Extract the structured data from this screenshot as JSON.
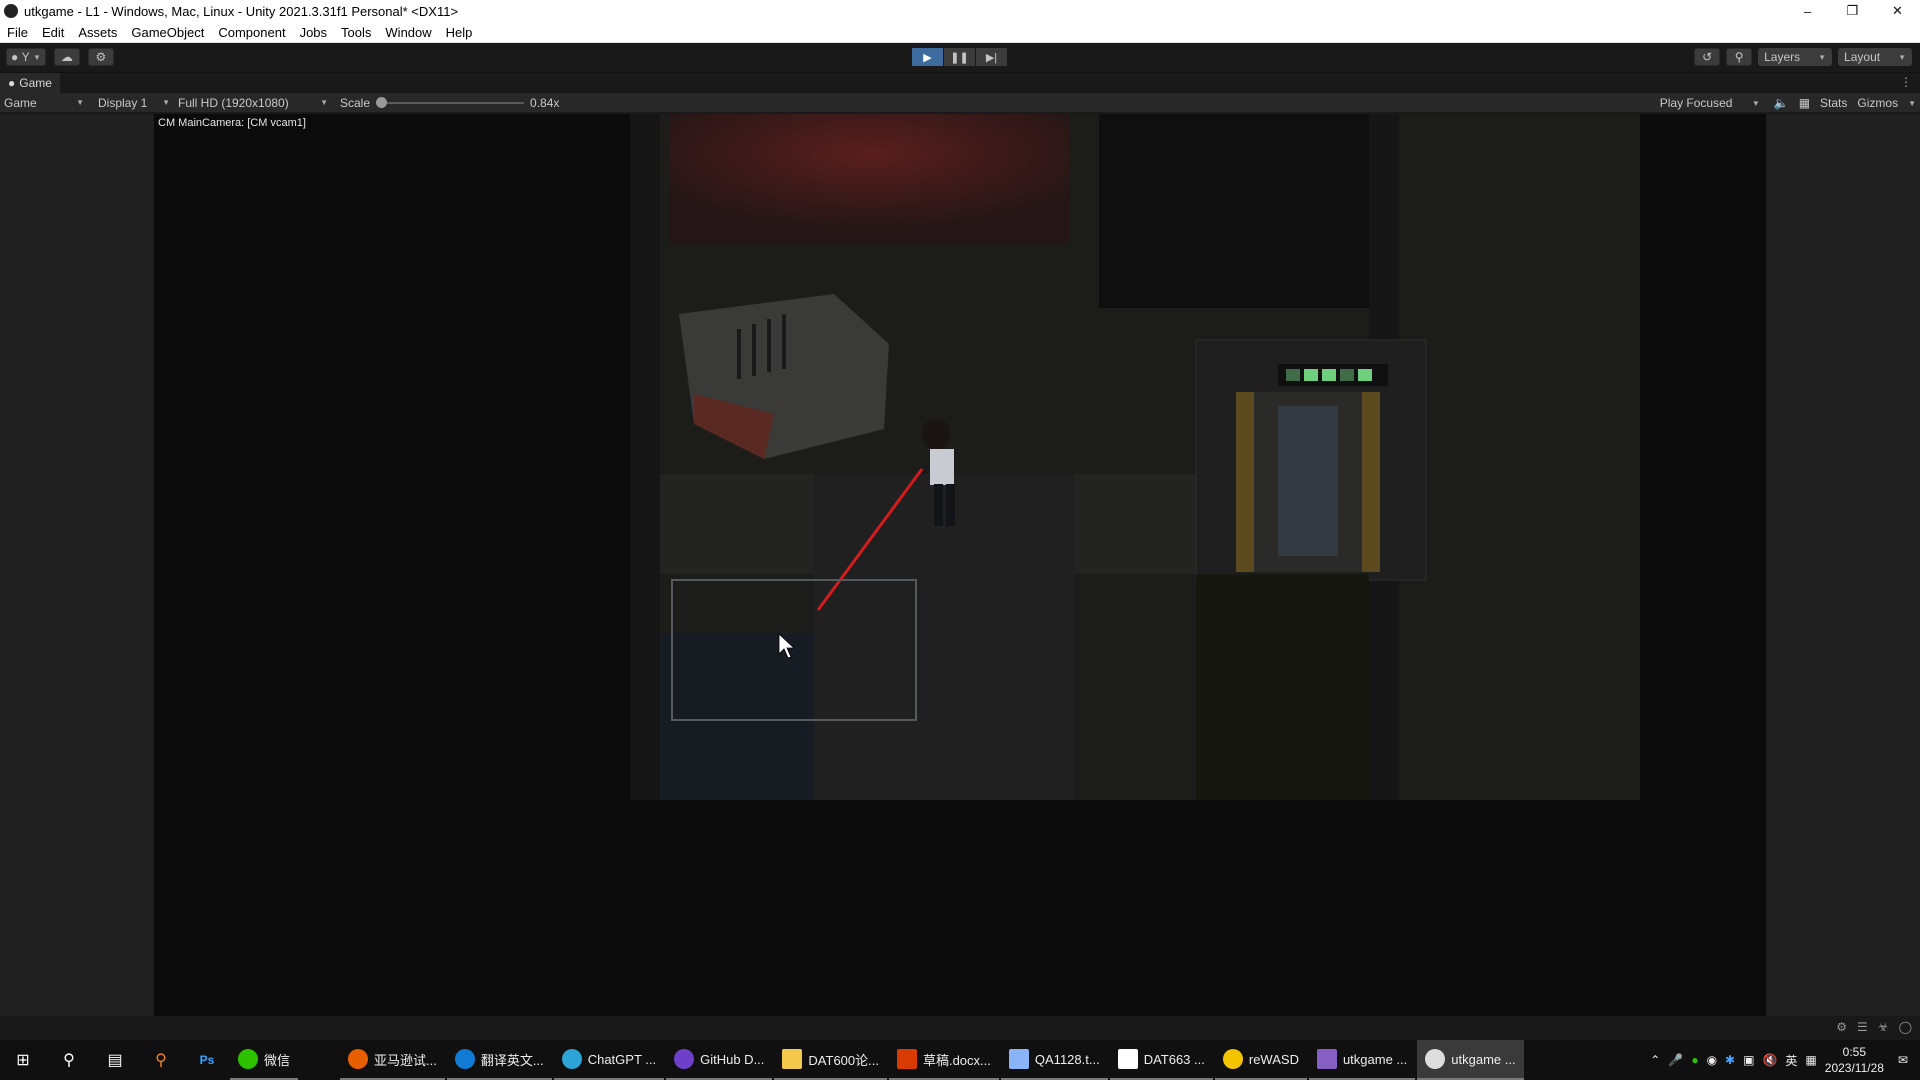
{
  "window": {
    "title": "utkgame - L1 - Windows, Mac, Linux - Unity 2021.3.31f1 Personal* <DX11>"
  },
  "menu": [
    "File",
    "Edit",
    "Assets",
    "GameObject",
    "Component",
    "Jobs",
    "Tools",
    "Window",
    "Help"
  ],
  "toolbar": {
    "account_label": "Y",
    "layers_label": "Layers",
    "layout_label": "Layout"
  },
  "tab": {
    "label": "Game"
  },
  "gamebar": {
    "view_mode": "Game",
    "display": "Display 1",
    "resolution": "Full HD (1920x1080)",
    "scale_label": "Scale",
    "scale_value": "0.84x",
    "scale_fraction": 0.0,
    "play_mode": "Play Focused",
    "stats_label": "Stats",
    "gizmos_label": "Gizmos"
  },
  "game": {
    "camera_label": "CM MainCamera: [CM vcam1]"
  },
  "taskbar": {
    "apps": [
      {
        "label": "微信",
        "color": "#2dc100"
      },
      {
        "label": "亚马逊试...",
        "color": "#e66000"
      },
      {
        "label": "翻译英文...",
        "color": "#0f7bd5"
      },
      {
        "label": "ChatGPT ...",
        "color": "#2ea3d6"
      },
      {
        "label": "GitHub D...",
        "color": "#6e40c9"
      },
      {
        "label": "DAT600论...",
        "color": "#f2c94c"
      },
      {
        "label": "草稿.docx...",
        "color": "#d83b01"
      },
      {
        "label": "QA1128.t...",
        "color": "#8ab4f8"
      },
      {
        "label": "DAT663 ...",
        "color": "#ffffff"
      },
      {
        "label": "reWASD",
        "color": "#f5c400"
      },
      {
        "label": "utkgame ...",
        "color": "#865fc5"
      },
      {
        "label": "utkgame ...",
        "color": "#dddddd"
      }
    ],
    "ime": "英",
    "time": "0:55",
    "date": "2023/11/28"
  }
}
